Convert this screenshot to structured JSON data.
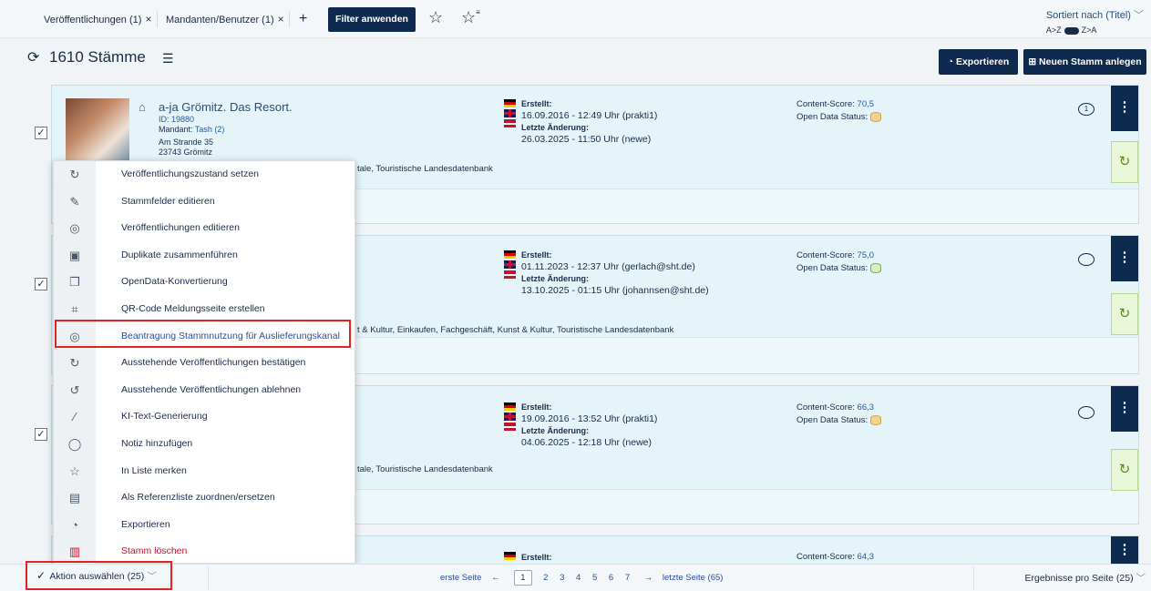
{
  "filters": {
    "chips": [
      {
        "label": "Veröffentlichungen (1)"
      },
      {
        "label": "Mandanten/Benutzer (1)"
      }
    ],
    "add_symbol": "+",
    "close_symbol": "×",
    "apply_label": "Filter anwenden"
  },
  "sort": {
    "label": "Sortiert nach (Titel)",
    "az": "A>Z",
    "za": "Z>A"
  },
  "header": {
    "count": "1610 Stämme",
    "export_label": "Exportieren",
    "new_label": "Neuen Stamm anlegen"
  },
  "cards": [
    {
      "title": "a-ja Grömitz. Das Resort.",
      "id": "ID: 19880",
      "mandant_prefix": "Mandant: ",
      "mandant": "Tash (2)",
      "street": "Am Strande 35",
      "city": "23743 Grömitz",
      "categories": "tale, Touristische Landesdatenbank",
      "created_label": "Erstellt:",
      "created": "16.09.2016 - 12:49 Uhr (prakti1)",
      "changed_label": "Letzte Änderung:",
      "changed": "26.03.2025 - 11:50 Uhr (newe)",
      "score_label": "Content-Score: ",
      "score": "70,5",
      "od_label": "Open Data Status:",
      "comments": "1"
    },
    {
      "categories": "t & Kultur, Einkaufen, Fachgeschäft, Kunst & Kultur, Touristische Landesdatenbank",
      "created_label": "Erstellt:",
      "created": "01.11.2023 - 12:37 Uhr (gerlach@sht.de)",
      "changed_label": "Letzte Änderung:",
      "changed": "13.10.2025 - 01:15 Uhr (johannsen@sht.de)",
      "score_label": "Content-Score: ",
      "score": "75,0",
      "od_label": "Open Data Status:"
    },
    {
      "categories": "tale, Touristische Landesdatenbank",
      "created_label": "Erstellt:",
      "created": "19.09.2016 - 13:52 Uhr (prakti1)",
      "changed_label": "Letzte Änderung:",
      "changed": "04.06.2025 - 12:18 Uhr (newe)",
      "score_label": "Content-Score: ",
      "score": "66,3",
      "od_label": "Open Data Status:"
    },
    {
      "created_label": "Erstellt:",
      "score_label": "Content-Score: ",
      "score": "64,3"
    }
  ],
  "menu": {
    "items": [
      {
        "label": "Veröffentlichungszustand setzen",
        "icon": "publish-state-icon"
      },
      {
        "label": "Stammfelder editieren",
        "icon": "pencil-icon"
      },
      {
        "label": "Veröffentlichungen editieren",
        "icon": "globe-icon"
      },
      {
        "label": "Duplikate zusammenführen",
        "icon": "merge-icon"
      },
      {
        "label": "OpenData-Konvertierung",
        "icon": "copy-icon"
      },
      {
        "label": "QR-Code Meldungsseite erstellen",
        "icon": "qr-code-icon"
      },
      {
        "label": "Beantragung Stammnutzung für Auslieferungskanal",
        "icon": "globe-request-icon"
      },
      {
        "label": "Ausstehende Veröffentlichungen bestätigen",
        "icon": "confirm-icon"
      },
      {
        "label": "Ausstehende Veröffentlichungen ablehnen",
        "icon": "reject-icon"
      },
      {
        "label": "KI-Text-Generierung",
        "icon": "magic-wand-icon"
      },
      {
        "label": "Notiz hinzufügen",
        "icon": "speech-bubble-icon"
      },
      {
        "label": "In Liste merken",
        "icon": "star-list-icon"
      },
      {
        "label": "Als Referenzliste zuordnen/ersetzen",
        "icon": "reference-list-icon"
      },
      {
        "label": "Exportieren",
        "icon": "pie-chart-icon"
      },
      {
        "label": "Stamm löschen",
        "icon": "trash-icon"
      }
    ]
  },
  "bottom": {
    "action_label": "Aktion auswählen",
    "action_count": "(25)",
    "first_page": "erste Seite",
    "pages": [
      "1",
      "2",
      "3",
      "4",
      "5",
      "6",
      "7"
    ],
    "last_page": "letzte Seite (65)",
    "per_page": "Ergebnisse pro Seite (25)"
  },
  "colors": {
    "primary": "#0f2a4f",
    "highlight": "#e0241f",
    "card_bg": "#e4f4f8"
  }
}
